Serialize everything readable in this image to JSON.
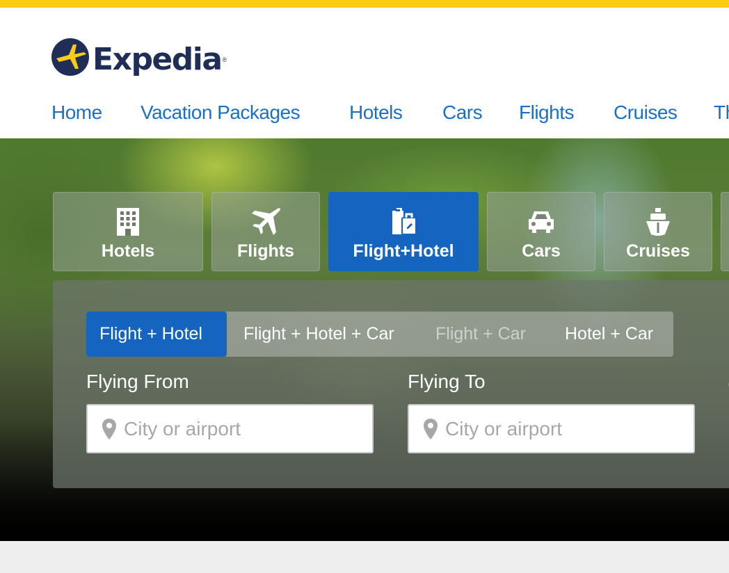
{
  "brand": {
    "name": "Expedia",
    "reg_mark": "®"
  },
  "colors": {
    "accent_strip": "#fccc13",
    "brand_blue": "#1565c0",
    "nav_link": "#1a70c9",
    "logo_navy": "#1e2e56"
  },
  "nav": {
    "items": [
      {
        "label": "Home"
      },
      {
        "label": "Vacation Packages"
      },
      {
        "label": "Hotels"
      },
      {
        "label": "Cars"
      },
      {
        "label": "Flights"
      },
      {
        "label": "Cruises"
      },
      {
        "label": "Th"
      }
    ]
  },
  "product_tabs": {
    "items": [
      {
        "label": "Hotels",
        "icon": "hotel-building-icon"
      },
      {
        "label": "Flights",
        "icon": "airplane-icon"
      },
      {
        "label": "Flight+Hotel",
        "icon": "luggage-icon",
        "active": true
      },
      {
        "label": "Cars",
        "icon": "car-icon"
      },
      {
        "label": "Cruises",
        "icon": "cruise-ship-icon"
      }
    ]
  },
  "package_tabs": {
    "items": [
      {
        "label": "Flight + Hotel",
        "active": true
      },
      {
        "label": "Flight + Hotel + Car"
      },
      {
        "label": "Flight + Car",
        "disabled": true
      },
      {
        "label": "Hotel + Car"
      }
    ]
  },
  "search": {
    "from": {
      "label": "Flying From",
      "placeholder": "City or airport",
      "value": "",
      "icon": "map-pin-icon"
    },
    "to": {
      "label": "Flying To",
      "placeholder": "City or airport",
      "value": "",
      "icon": "map-pin-icon"
    },
    "next_label_partial": "("
  }
}
